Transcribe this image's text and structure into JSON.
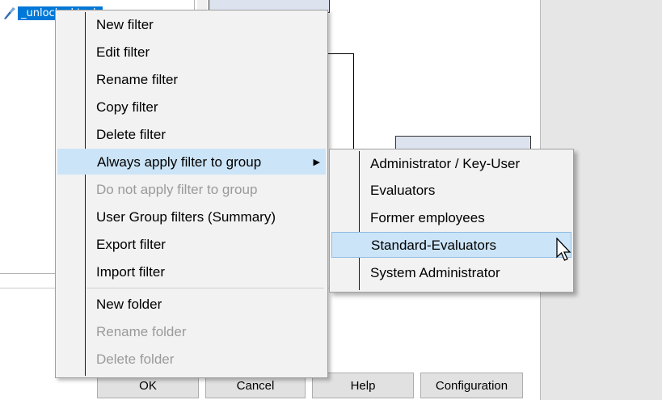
{
  "tree": {
    "selected_label": "_unlocked task"
  },
  "buttons": {
    "ok": "OK",
    "cancel": "Cancel",
    "help": "Help",
    "configuration": "Configuration"
  },
  "context_menu": {
    "items": [
      {
        "label": "New filter",
        "enabled": true
      },
      {
        "label": "Edit filter",
        "enabled": true
      },
      {
        "label": "Rename filter",
        "enabled": true
      },
      {
        "label": "Copy filter",
        "enabled": true
      },
      {
        "label": "Delete filter",
        "enabled": true
      },
      {
        "label": "Always apply filter to group",
        "enabled": true,
        "has_submenu": true,
        "highlighted": true
      },
      {
        "label": "Do not apply filter to group",
        "enabled": false
      },
      {
        "label": "User Group filters (Summary)",
        "enabled": true
      },
      {
        "label": "Export filter",
        "enabled": true
      },
      {
        "label": "Import filter",
        "enabled": true
      },
      {
        "label": "New folder",
        "enabled": true
      },
      {
        "label": "Rename folder",
        "enabled": false
      },
      {
        "label": "Delete folder",
        "enabled": false
      }
    ],
    "submenu_arrow": "▶"
  },
  "submenu": {
    "items": [
      {
        "label": "Administrator / Key-User"
      },
      {
        "label": "Evaluators"
      },
      {
        "label": "Former employees"
      },
      {
        "label": "Standard-Evaluators",
        "highlighted": true
      },
      {
        "label": "System Administrator"
      }
    ]
  },
  "colors": {
    "highlight": "#cce4f7",
    "selection": "#0078d7",
    "disabled_text": "#9a9a9a"
  }
}
